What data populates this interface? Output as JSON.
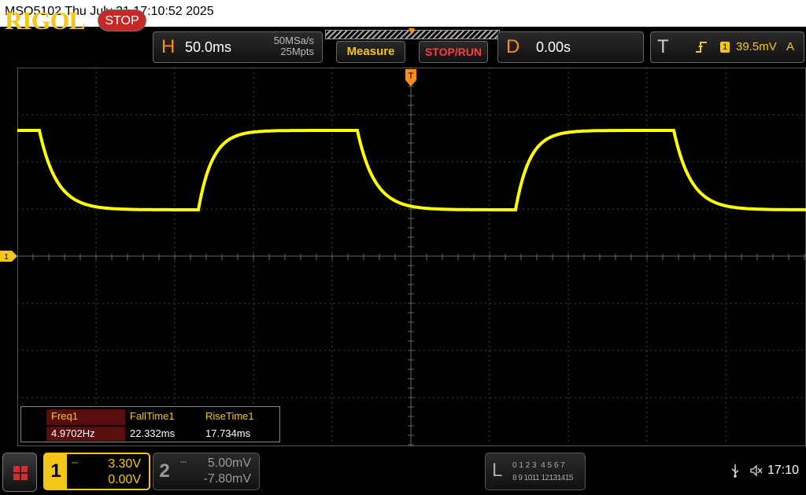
{
  "titlebar": {
    "text": "MSO5102  Thu July 31 17:10:52 2025"
  },
  "brand": {
    "logo": "RIGOL",
    "run_state": "STOP"
  },
  "horizontal": {
    "letter": "H",
    "timebase": "50.0ms",
    "sample_rate": "50MSa/s",
    "memory_depth": "25Mpts"
  },
  "buttons": {
    "measure": "Measure",
    "stop_run": "STOP/RUN"
  },
  "delay": {
    "letter": "D",
    "value": "0.00s"
  },
  "trigger": {
    "letter": "T",
    "source": "1",
    "level": "39.5mV",
    "coupling": "A",
    "edge_icon": "rising-edge-icon"
  },
  "markers": {
    "trigger_pos": "T",
    "ch1_ground": "1"
  },
  "measurements": {
    "headers": [
      "Freq1",
      "FallTime1",
      "RiseTime1"
    ],
    "values": [
      "4.9702Hz",
      "22.332ms",
      "17.734ms"
    ]
  },
  "channel1": {
    "number": "1",
    "scale": "3.30V",
    "offset": "0.00V",
    "color": "#f5c518"
  },
  "channel2": {
    "number": "2",
    "scale": "5.00mV",
    "offset": "-7.80mV"
  },
  "logic": {
    "letter": "L",
    "row1": "0 1 2 3  4 5 6 7",
    "row2": "8 9 1011 12131415"
  },
  "status": {
    "time": "17:10"
  },
  "colors": {
    "trace": "#ffff00",
    "accent": "#ff8c1a",
    "stop": "#c62828"
  }
}
